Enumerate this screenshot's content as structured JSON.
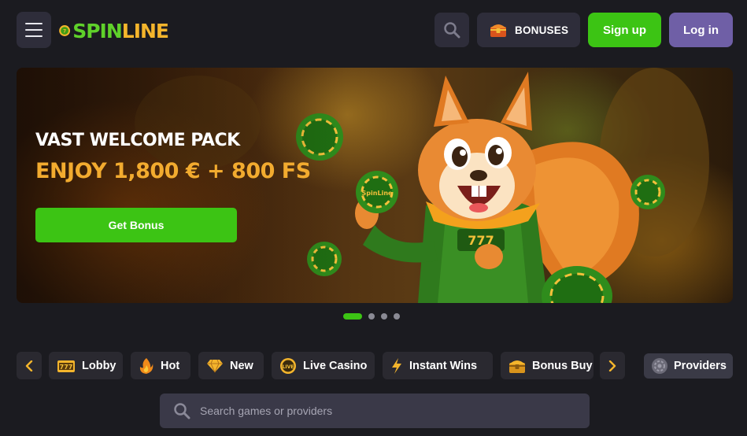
{
  "header": {
    "logo": {
      "part1": "SPIN",
      "part2": "LINE"
    },
    "bonuses_label": "BONUSES",
    "signup_label": "Sign up",
    "login_label": "Log in"
  },
  "banner": {
    "title": "VAST WELCOME PACK",
    "subtitle": "ENJOY 1,800 € + 800 FS",
    "cta_label": "Get Bonus",
    "chip_text": "SpinLine",
    "slide_count": 4,
    "active_slide": 1
  },
  "categories": {
    "items": [
      {
        "label": "Lobby",
        "icon": "slot-777-icon"
      },
      {
        "label": "Hot",
        "icon": "flame-icon"
      },
      {
        "label": "New",
        "icon": "diamond-icon"
      },
      {
        "label": "Live Casino",
        "icon": "live-icon"
      },
      {
        "label": "Instant Wins",
        "icon": "lightning-icon"
      },
      {
        "label": "Bonus Buy",
        "icon": "treasure-chest-icon"
      }
    ],
    "providers_label": "Providers"
  },
  "search": {
    "placeholder": "Search games or providers",
    "value": ""
  },
  "colors": {
    "background": "#1b1b20",
    "accent_green": "#3cc414",
    "accent_purple": "#6f5fa6",
    "accent_orange": "#f2ab2f",
    "button_dark": "#2e2d3a"
  }
}
